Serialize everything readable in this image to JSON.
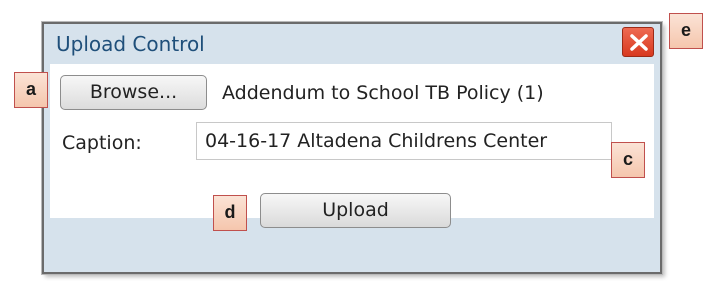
{
  "dialog": {
    "title": "Upload Control",
    "close_icon": "close-x-icon"
  },
  "form": {
    "browse_label": "Browse...",
    "selected_file": "Addendum to School TB Policy (1)",
    "caption_label": "Caption:",
    "caption_value": "04-16-17 Altadena Childrens Center",
    "upload_label": "Upload"
  },
  "annotations": {
    "a": "a",
    "c": "c",
    "d": "d",
    "e": "e"
  },
  "colors": {
    "title_text": "#1f4f7a",
    "dialog_background": "#d6e2ec",
    "close_button": "#d8391f",
    "annotation_fill": "#f5c6ad",
    "annotation_border": "#c0504d"
  }
}
